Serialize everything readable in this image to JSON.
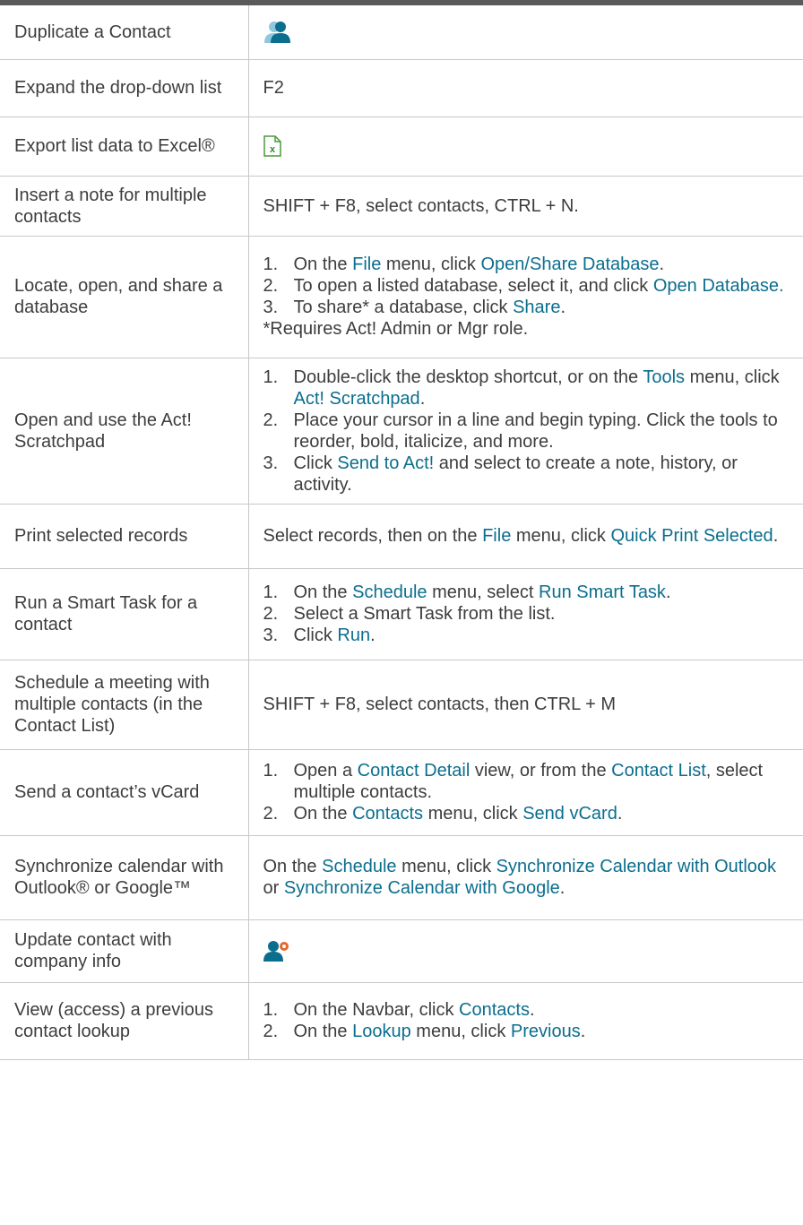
{
  "colors": {
    "text": "#3d3d3d",
    "link": "#0b6e8e",
    "border": "#c8c8c8",
    "topbar": "#5a5a5a"
  },
  "rows": [
    {
      "task": "Duplicate a Contact",
      "icon": "duplicate-contact-icon"
    },
    {
      "task": "Expand the drop-down list",
      "text": "F2"
    },
    {
      "task": "Export list data to Excel®",
      "icon": "excel-export-icon"
    },
    {
      "task": "Insert a note for multiple contacts",
      "text": "SHIFT + F8, select contacts, CTRL + N."
    },
    {
      "task": "Locate, open, and share a database",
      "steps": [
        {
          "num": "1.",
          "parts": [
            {
              "t": "On the "
            },
            {
              "t": "File",
              "link": true
            },
            {
              "t": " menu, click "
            },
            {
              "t": "Open/Share Database",
              "link": true
            },
            {
              "t": "."
            }
          ]
        },
        {
          "num": "2.",
          "parts": [
            {
              "t": "To open a listed database, select it, and click "
            },
            {
              "t": "Open Database.",
              "link": true
            }
          ]
        },
        {
          "num": "3.",
          "parts": [
            {
              "t": "To share* a database, click "
            },
            {
              "t": "Share",
              "link": true
            },
            {
              "t": "."
            }
          ]
        }
      ],
      "note": "*Requires Act! Admin or Mgr role."
    },
    {
      "task": "Open and use the Act! Scratchpad",
      "steps": [
        {
          "num": "1.",
          "parts": [
            {
              "t": "Double-click the desktop shortcut, or on the "
            },
            {
              "t": "Tools",
              "link": true
            },
            {
              "t": " menu, click "
            },
            {
              "t": "Act! Scratchpad",
              "link": true
            },
            {
              "t": "."
            }
          ]
        },
        {
          "num": "2.",
          "parts": [
            {
              "t": "Place your cursor in a line and begin typing. Click the tools to reorder, bold, italicize, and more."
            }
          ]
        },
        {
          "num": "3.",
          "parts": [
            {
              "t": "Click "
            },
            {
              "t": "Send to Act!",
              "link": true
            },
            {
              "t": " and select to create a note, history, or activity."
            }
          ]
        }
      ]
    },
    {
      "task": "Print selected records",
      "parts": [
        {
          "t": "Select records, then on the "
        },
        {
          "t": "File",
          "link": true
        },
        {
          "t": " menu, click "
        },
        {
          "t": "Quick Print Selected",
          "link": true
        },
        {
          "t": "."
        }
      ]
    },
    {
      "task": "Run a Smart Task for a contact",
      "steps": [
        {
          "num": "1.",
          "parts": [
            {
              "t": "On the "
            },
            {
              "t": "Schedule",
              "link": true
            },
            {
              "t": " menu, select "
            },
            {
              "t": "Run Smart Task",
              "link": true
            },
            {
              "t": "."
            }
          ]
        },
        {
          "num": "2.",
          "parts": [
            {
              "t": "Select a Smart Task from the list."
            }
          ]
        },
        {
          "num": "3.",
          "parts": [
            {
              "t": "Click "
            },
            {
              "t": "Run",
              "link": true
            },
            {
              "t": "."
            }
          ]
        }
      ]
    },
    {
      "task": "Schedule a meeting with multiple contacts (in the Contact List)",
      "text": "SHIFT + F8, select contacts, then CTRL + M"
    },
    {
      "task": "Send a contact’s vCard",
      "steps": [
        {
          "num": "1.",
          "parts": [
            {
              "t": "Open a "
            },
            {
              "t": "Contact Detail",
              "link": true
            },
            {
              "t": " view, or from the "
            },
            {
              "t": "Contact List",
              "link": true
            },
            {
              "t": ", select multiple contacts."
            }
          ]
        },
        {
          "num": "2.",
          "parts": [
            {
              "t": "On the "
            },
            {
              "t": "Contacts",
              "link": true
            },
            {
              "t": " menu, click "
            },
            {
              "t": "Send vCard",
              "link": true
            },
            {
              "t": "."
            }
          ]
        }
      ]
    },
    {
      "task": "Synchronize calendar with Outlook® or Google™",
      "parts": [
        {
          "t": "On the "
        },
        {
          "t": "Schedule",
          "link": true
        },
        {
          "t": " menu, click "
        },
        {
          "t": "Synchronize Calendar with Outlook",
          "link": true
        },
        {
          "t": " or "
        },
        {
          "t": "Synchronize Calendar with Google",
          "link": true
        },
        {
          "t": "."
        }
      ]
    },
    {
      "task": "Update contact with company info",
      "icon": "update-contact-icon"
    },
    {
      "task": "View (access) a previous contact lookup",
      "steps": [
        {
          "num": "1.",
          "parts": [
            {
              "t": "On the Navbar, click "
            },
            {
              "t": "Contacts",
              "link": true
            },
            {
              "t": "."
            }
          ]
        },
        {
          "num": "2.",
          "parts": [
            {
              "t": "On the "
            },
            {
              "t": "Lookup",
              "link": true
            },
            {
              "t": " menu, click "
            },
            {
              "t": "Previous",
              "link": true
            },
            {
              "t": "."
            }
          ]
        }
      ]
    }
  ]
}
